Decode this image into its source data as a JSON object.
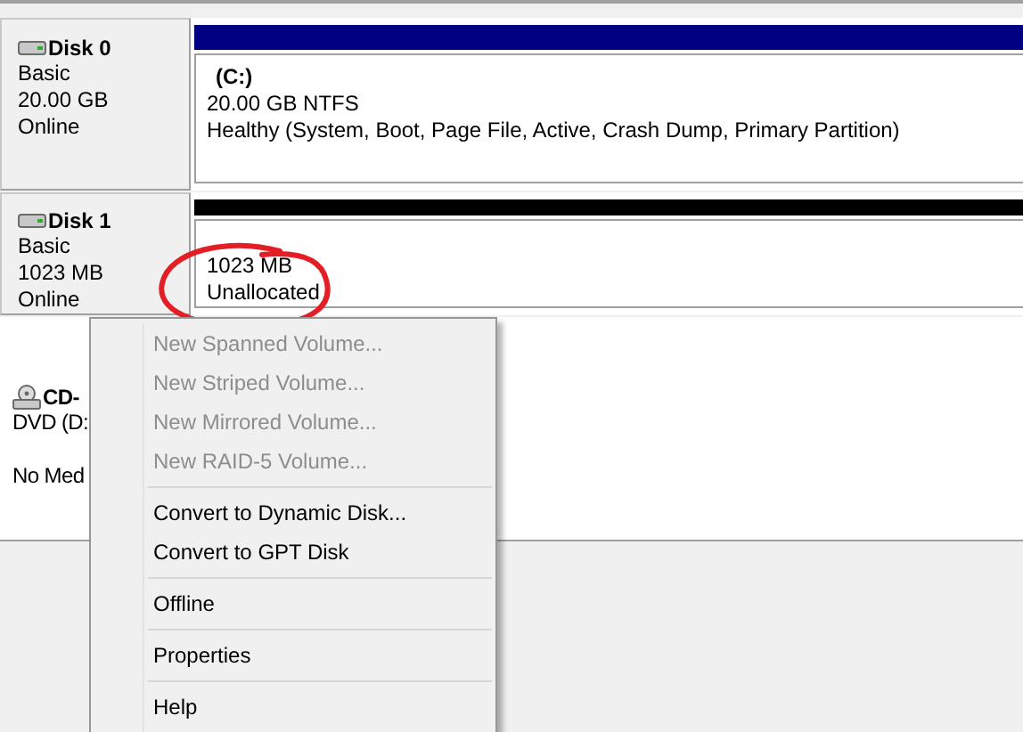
{
  "disks": [
    {
      "kind": "disk",
      "name": "Disk 0",
      "type": "Basic",
      "size": "20.00 GB",
      "status": "Online",
      "volume": {
        "kind": "primary",
        "label": "(C:)",
        "size": "20.00 GB NTFS",
        "status": "Healthy (System, Boot, Page File, Active, Crash Dump, Primary Partition)"
      }
    },
    {
      "kind": "disk",
      "name": "Disk 1",
      "type": "Basic",
      "size": "1023 MB",
      "status": "Online",
      "volume": {
        "kind": "unallocated",
        "size": "1023 MB",
        "status": "Unallocated"
      }
    },
    {
      "kind": "cdrom",
      "name": "CD-",
      "type": "DVD (D:",
      "status": "No Med"
    }
  ],
  "context_menu": {
    "items": [
      {
        "kind": "item",
        "label": "New Spanned Volume...",
        "disabled": true
      },
      {
        "kind": "item",
        "label": "New Striped Volume...",
        "disabled": true
      },
      {
        "kind": "item",
        "label": "New Mirrored Volume...",
        "disabled": true
      },
      {
        "kind": "item",
        "label": "New RAID-5 Volume...",
        "disabled": true
      },
      {
        "kind": "separator"
      },
      {
        "kind": "item",
        "label": "Convert to Dynamic Disk...",
        "disabled": false
      },
      {
        "kind": "item",
        "label": "Convert to GPT Disk",
        "disabled": false
      },
      {
        "kind": "separator"
      },
      {
        "kind": "item",
        "label": "Offline",
        "disabled": false
      },
      {
        "kind": "separator"
      },
      {
        "kind": "item",
        "label": "Properties",
        "disabled": false
      },
      {
        "kind": "separator"
      },
      {
        "kind": "item",
        "label": "Help",
        "disabled": false
      }
    ]
  }
}
